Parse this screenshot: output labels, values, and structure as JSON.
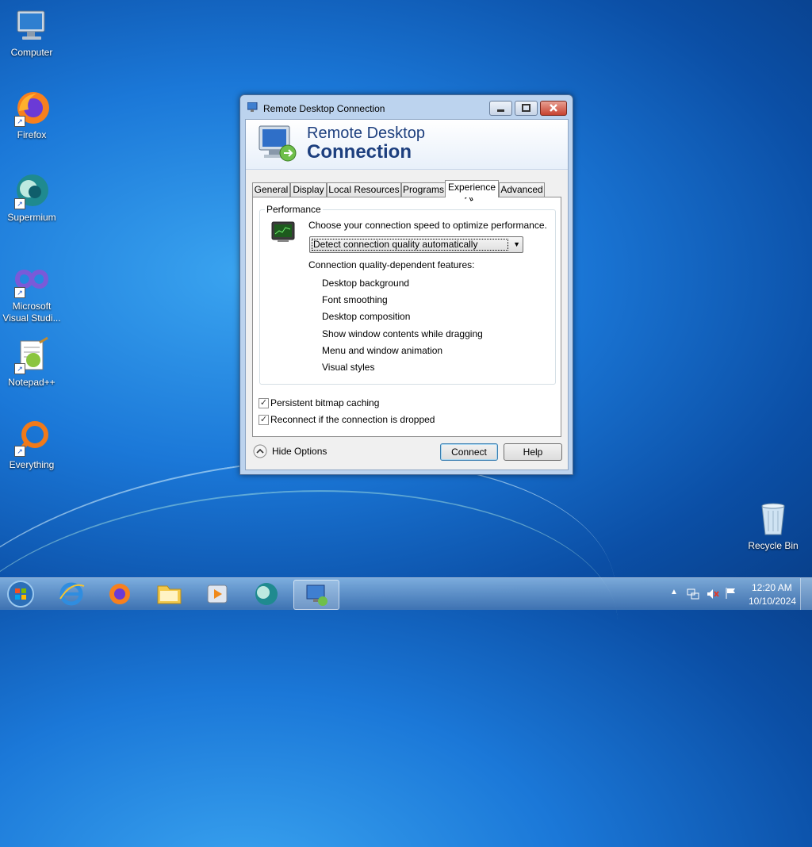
{
  "desktop": {
    "icons": [
      {
        "label": "Computer",
        "icon": "computer-icon"
      },
      {
        "label": "Firefox",
        "icon": "firefox-icon"
      },
      {
        "label": "Supermium",
        "icon": "supermium-icon"
      },
      {
        "label": "Microsoft Visual Studio Code",
        "line1": "Microsoft",
        "line2": "Visual Studi...",
        "icon": "vscode-icon"
      },
      {
        "label": "Notepad++",
        "icon": "notepadpp-icon"
      },
      {
        "label": "Everything",
        "icon": "everything-icon"
      },
      {
        "label": "Recycle Bin",
        "icon": "recycle-bin-icon"
      }
    ]
  },
  "window": {
    "title": "Remote Desktop Connection",
    "banner_line1": "Remote Desktop",
    "banner_line2": "Connection",
    "tabs": [
      {
        "label": "General"
      },
      {
        "label": "Display"
      },
      {
        "label": "Local Resources"
      },
      {
        "label": "Programs"
      },
      {
        "label": "Experience",
        "active": true
      },
      {
        "label": "Advanced"
      }
    ],
    "performance": {
      "group_label": "Performance",
      "prompt": "Choose your connection speed to optimize performance.",
      "speed_selected": "Detect connection quality automatically",
      "features_heading": "Connection quality-dependent features:",
      "features": [
        "Desktop background",
        "Font smoothing",
        "Desktop composition",
        "Show window contents while dragging",
        "Menu and window animation",
        "Visual styles"
      ]
    },
    "options": [
      {
        "label": "Persistent bitmap caching",
        "checked": true
      },
      {
        "label": "Reconnect if the connection is dropped",
        "checked": true
      }
    ],
    "hide_options_label": "Hide Options",
    "connect_label": "Connect",
    "help_label": "Help"
  },
  "taskbar": {
    "apps": [
      "start-orb-icon",
      "internet-explorer-icon",
      "firefox-icon",
      "file-explorer-icon",
      "media-player-icon",
      "supermium-icon",
      "remote-desktop-icon"
    ],
    "clock_time": "12:20 AM",
    "clock_date": "10/10/2024"
  },
  "colors": {
    "accent": "#1d3f7e",
    "desktop": "#1b78d8",
    "close": "#c7422f"
  }
}
